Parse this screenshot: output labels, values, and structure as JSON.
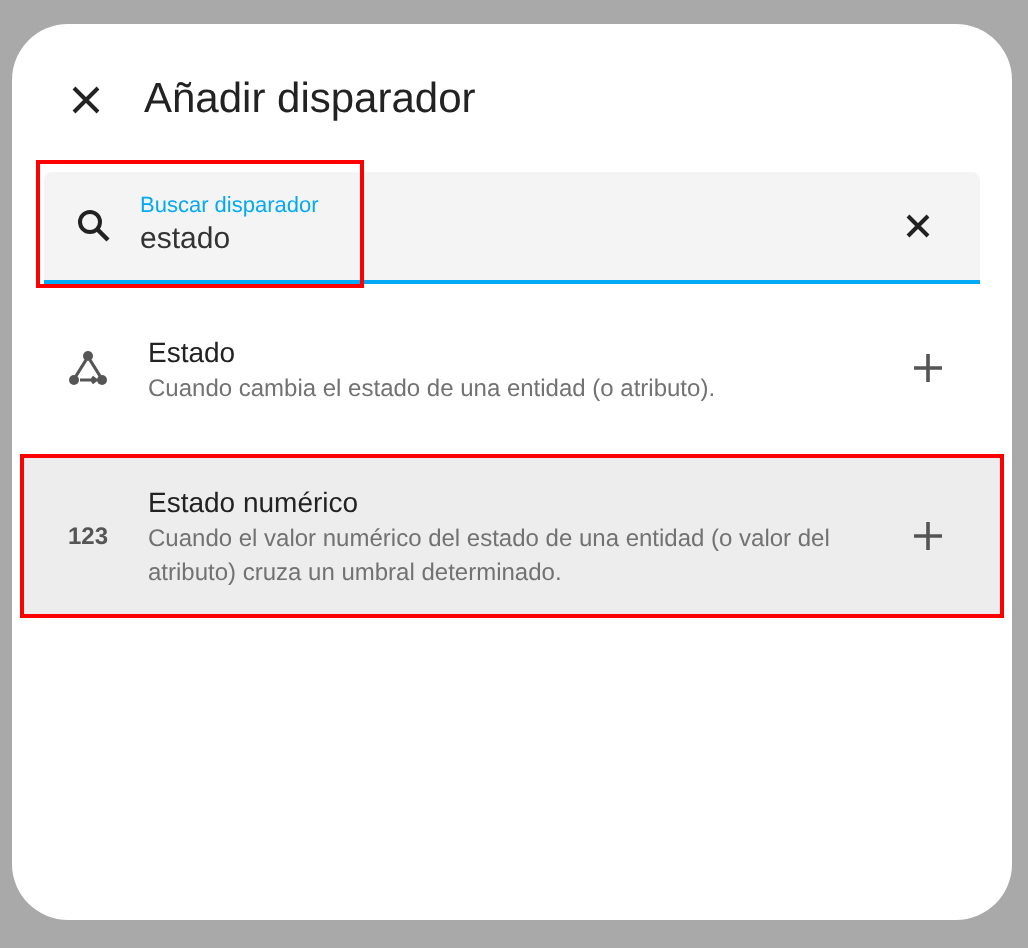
{
  "dialog": {
    "title": "Añadir disparador"
  },
  "search": {
    "label": "Buscar disparador",
    "value": "estado",
    "highlighted": true
  },
  "items": [
    {
      "kind": "state",
      "title": "Estado",
      "description": "Cuando cambia el estado de una entidad (o atributo).",
      "selected": false,
      "highlighted": false
    },
    {
      "kind": "numeric",
      "icon_text": "123",
      "title": "Estado numérico",
      "description": "Cuando el valor numérico del estado de una entidad (o valor del atributo) cruza un umbral determinado.",
      "selected": true,
      "highlighted": true
    }
  ]
}
